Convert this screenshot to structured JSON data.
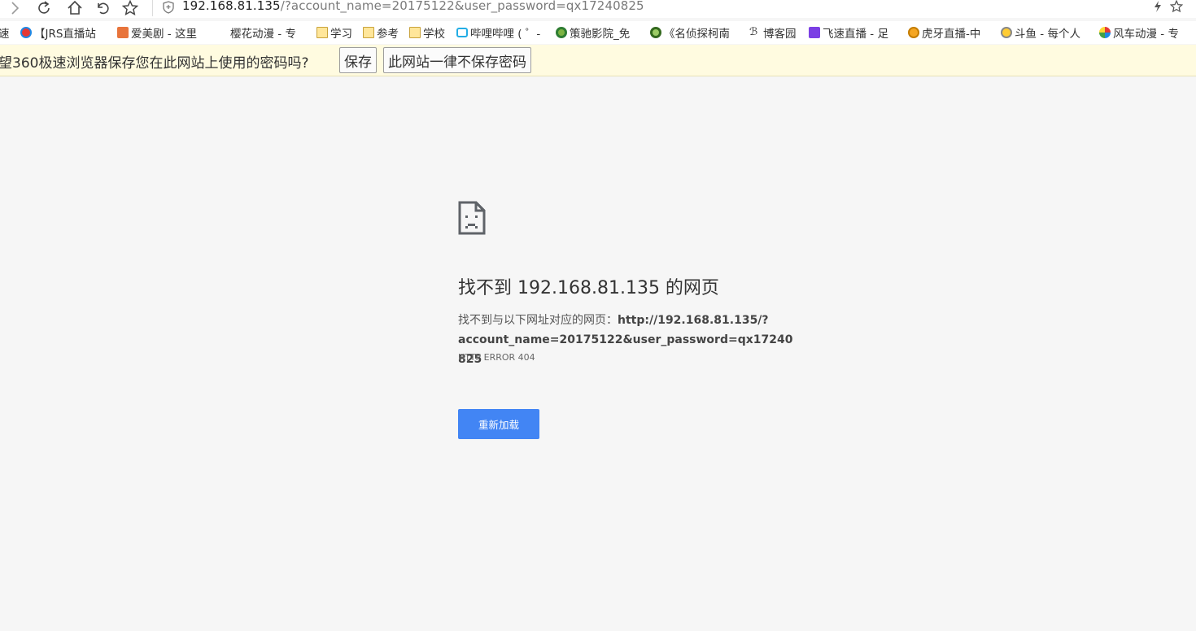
{
  "toolbar": {
    "url_host": "192.168.81.135",
    "url_rest": "/?account_name=20175122&user_password=qx17240825",
    "icons": [
      "forward-icon",
      "reload-icon",
      "home-icon",
      "undo-icon",
      "star-icon",
      "shield-icon",
      "bolt-icon",
      "bookmark-star-icon"
    ]
  },
  "bookmarks": [
    {
      "label": "速",
      "icon": "none"
    },
    {
      "label": "【JRS直播站",
      "icon": "jrs-icon"
    },
    {
      "label": "爱美剧 - 这里",
      "icon": "meiju-icon"
    },
    {
      "label": "樱花动漫 - 专",
      "icon": "sakura-icon"
    },
    {
      "label": "学习",
      "icon": "folder-icon"
    },
    {
      "label": "参考",
      "icon": "folder-icon"
    },
    {
      "label": "学校",
      "icon": "folder-icon"
    },
    {
      "label": "哔哩哔哩 ( ゜-",
      "icon": "bilibili-icon"
    },
    {
      "label": "策驰影院_免",
      "icon": "cechi-icon"
    },
    {
      "label": "《名侦探柯南",
      "icon": "conan-icon"
    },
    {
      "label": "博客园",
      "icon": "cnblogs-icon"
    },
    {
      "label": "飞速直播 - 足",
      "icon": "feisu-icon"
    },
    {
      "label": "虎牙直播-中",
      "icon": "huya-icon"
    },
    {
      "label": "斗鱼 - 每个人",
      "icon": "douyu-icon"
    },
    {
      "label": "风车动漫 - 专",
      "icon": "fengche-icon"
    }
  ],
  "infobar": {
    "message": "望360极速浏览器保存您在此网站上使用的密码吗?",
    "save_label": "保存",
    "never_label": "此网站一律不保存密码"
  },
  "error": {
    "title": "找不到 192.168.81.135 的网页",
    "desc_prefix": "找不到与以下网址对应的网页：",
    "desc_url": "http://192.168.81.135/?account_name=20175122&user_password=qx17240825",
    "code": "HTTP ERROR 404",
    "reload_label": "重新加载"
  },
  "colors": {
    "page_bg": "#f6f6f6",
    "infobar_bg": "#fffbe0",
    "reload_btn": "#4285f4"
  }
}
